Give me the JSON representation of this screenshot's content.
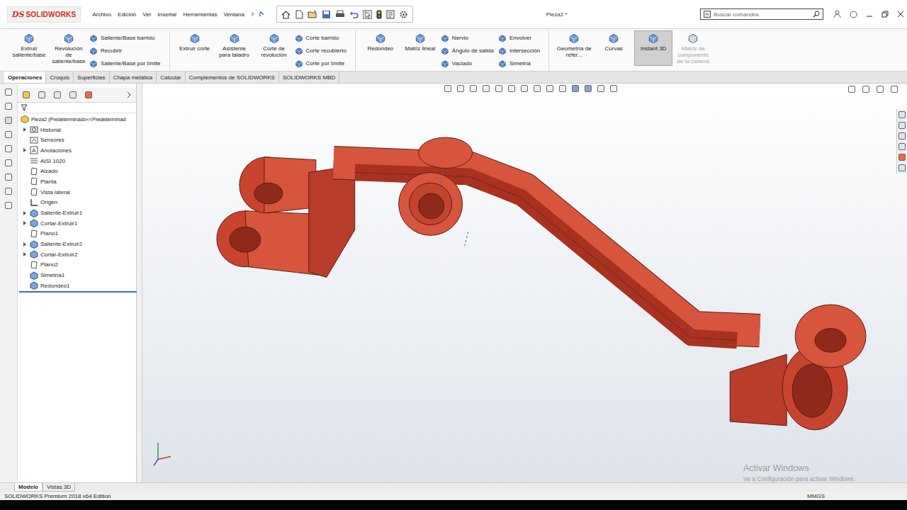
{
  "window": {
    "title": "Pieza2 *"
  },
  "logo": {
    "mark": "DS",
    "text": "SOLIDWORKS"
  },
  "menus": [
    "Archivo",
    "Edición",
    "Ver",
    "Insertar",
    "Herramientas",
    "Ventana",
    "?"
  ],
  "search": {
    "placeholder": "Buscar comandos"
  },
  "ribbon": [
    {
      "large": [
        {
          "label": "Extruir saliente/base",
          "selected": false,
          "disabled": false
        },
        {
          "label": "Revolución de saliente/base",
          "selected": false,
          "disabled": false
        }
      ],
      "small": [
        [
          "Saliente/Base barrido",
          "Recubrir",
          "Saliente/Base por límite"
        ]
      ]
    },
    {
      "large": [
        {
          "label": "Extruir corte",
          "selected": false,
          "disabled": false
        },
        {
          "label": "Asistente para taladro",
          "selected": false,
          "disabled": false
        },
        {
          "label": "Corte de revolución",
          "selected": false,
          "disabled": false
        }
      ],
      "small": [
        [
          "Corte barrido",
          "Corte recubierto",
          "Corte por límite"
        ]
      ]
    },
    {
      "large": [
        {
          "label": "Redondeo",
          "selected": false,
          "disabled": false
        },
        {
          "label": "Matriz lineal",
          "selected": false,
          "disabled": false
        }
      ],
      "small": [
        [
          "Nervio",
          "Ángulo de salida",
          "Vaciado"
        ],
        [
          "Envolver",
          "Intersección",
          "Simetría"
        ]
      ]
    },
    {
      "large": [
        {
          "label": "Geometría de refer...",
          "selected": false,
          "disabled": false
        },
        {
          "label": "Curvas",
          "selected": false,
          "disabled": false
        },
        {
          "label": "Instant 3D",
          "selected": true,
          "disabled": false
        },
        {
          "label": "Matriz de componente de la cadena",
          "selected": false,
          "disabled": true
        }
      ],
      "small": []
    }
  ],
  "tabs": [
    {
      "label": "Operaciones",
      "selected": true
    },
    {
      "label": "Croquis",
      "selected": false
    },
    {
      "label": "Superficies",
      "selected": false
    },
    {
      "label": "Chapa metálica",
      "selected": false
    },
    {
      "label": "Calcular",
      "selected": false
    },
    {
      "label": "Complementos de SOLIDWORKS",
      "selected": false
    },
    {
      "label": "SOLIDWORKS MBD",
      "selected": false
    }
  ],
  "tree": {
    "root": "Pieza2  (Predeterminado<<Predeterminad",
    "items": [
      {
        "label": "Historial",
        "expandable": true,
        "kind": "folder"
      },
      {
        "label": "Sensores",
        "expandable": false,
        "kind": "sensor"
      },
      {
        "label": "Anotaciones",
        "expandable": true,
        "kind": "annotation"
      },
      {
        "label": "AISI 1020",
        "expandable": false,
        "kind": "material"
      },
      {
        "label": "Alzado",
        "expandable": false,
        "kind": "plane"
      },
      {
        "label": "Planta",
        "expandable": false,
        "kind": "plane"
      },
      {
        "label": "Vista lateral",
        "expandable": false,
        "kind": "plane"
      },
      {
        "label": "Origen",
        "expandable": false,
        "kind": "origin"
      },
      {
        "label": "Saliente-Extruir1",
        "expandable": true,
        "kind": "feature"
      },
      {
        "label": "Cortar-Extruir1",
        "expandable": true,
        "kind": "feature"
      },
      {
        "label": "Plano1",
        "expandable": false,
        "kind": "plane"
      },
      {
        "label": "Saliente-Extruir2",
        "expandable": true,
        "kind": "feature"
      },
      {
        "label": "Cortar-Extruir2",
        "expandable": true,
        "kind": "feature"
      },
      {
        "label": "Plano2",
        "expandable": false,
        "kind": "plane"
      },
      {
        "label": "Simetría1",
        "expandable": false,
        "kind": "feature"
      },
      {
        "label": "Redondeo1",
        "expandable": false,
        "kind": "feature"
      }
    ]
  },
  "bottom_tabs": [
    {
      "label": "Modelo",
      "selected": true
    },
    {
      "label": "Vistas 3D",
      "selected": false
    }
  ],
  "status_bar": {
    "text": "SOLIDWORKS Premium 2018 x64 Edition",
    "units": "MMGS"
  },
  "watermark": {
    "title": "Activar Windows",
    "subtitle": "Ve a Configuración para activar Windows."
  }
}
